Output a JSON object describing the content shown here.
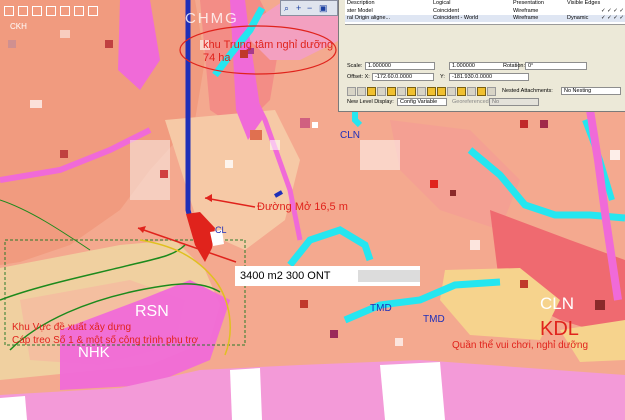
{
  "map": {
    "labels": {
      "resort_name": "khu Trung tâm nghỉ dưỡng",
      "resort_area": "74 ha",
      "road": "Đường Mở 16,5 m",
      "plot": "3400 m2 300 ONT",
      "zone_proposal_1": "Khu Vực đề xuất xây dựng",
      "zone_proposal_2": "Cáp treo Số 1 & một số công trình phụ trợ",
      "park": "Quần thể vui chơi, nghỉ dưỡng",
      "kdl": "KDL",
      "cln_upper": "CLN",
      "cln_lower": "CLN",
      "tmd_1": "TMD",
      "tmd_2": "TMD",
      "rsn": "RSN",
      "nhk": "NHK",
      "cl": "CL",
      "top_code": "CHMG",
      "tiny_code": "CKH"
    }
  },
  "properties_panel": {
    "headers": {
      "col1": "Description",
      "col2": "Logical",
      "col3": "Presentation",
      "col4": "Visible Edges"
    },
    "rows": [
      {
        "c1": "ster Model",
        "c2": "Coincident",
        "c3": "Wireframe",
        "c4": ""
      },
      {
        "c1": "ral Origin aligne...",
        "c2": "Coincident - World",
        "c3": "Wireframe",
        "c4": "Dynamic"
      }
    ],
    "scale_label": "Scale:",
    "scale_x": "1.000000",
    "scale_y": "1.000000",
    "rotation_label": "Rotation:",
    "rotation": "0°",
    "offset_label": "Offset: X:",
    "offset_x": "-172.60.0.0000",
    "offset_y_label": "Y:",
    "offset_y": "-181.930.0.0000",
    "nested_label": "Nested Attachments:",
    "nested_value": "No Nesting",
    "newlevel_label": "New Level Display:",
    "newlevel_value": "Config Variable",
    "georef_label": "Georeferenced:",
    "georef_value": "No"
  },
  "colors": {
    "zone_pink": "#f4a98f",
    "zone_magenta": "#f06ad8",
    "zone_cyan": "#25e6f0",
    "zone_yellow": "#f6d38d",
    "sea_violet": "#f39ad8",
    "label_red": "#e0231c",
    "label_blue": "#1f2fb8"
  }
}
